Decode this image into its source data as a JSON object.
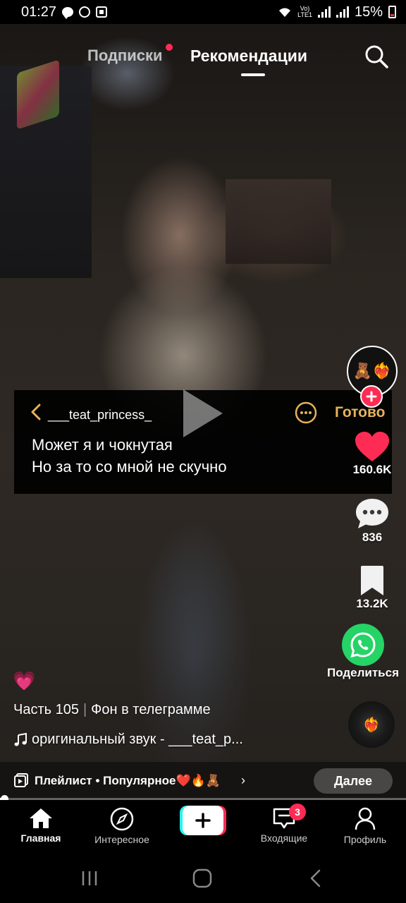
{
  "status_bar": {
    "time": "01:27",
    "lte_label": "Vo)\nLTE1",
    "battery": "15%"
  },
  "top_nav": {
    "tab_following": "Подписки",
    "tab_recommended": "Рекомендации",
    "active_tab": "Рекомендации"
  },
  "lyrics_card": {
    "username": "___teat_princess_",
    "done_label": "Готово",
    "line1": "Может я и чокнутая",
    "line2": "Но за то со мной не скучно"
  },
  "actions": {
    "avatar_emoji": "🧸❤️‍🔥",
    "likes": "160.6K",
    "comments": "836",
    "saves": "13.2K",
    "share_label": "Поделиться",
    "disc_emoji": "❤️‍🔥"
  },
  "caption": {
    "emoji": "💗",
    "part": "Часть 105",
    "text": "Фон в телеграмме",
    "sound": "оригинальный звук - ___teat_p..."
  },
  "playlist": {
    "label": "Плейлист • Популярное❤️🔥🧸",
    "next_label": "Далее"
  },
  "progress": {
    "fraction": 0.01
  },
  "bottom_nav": {
    "home": "Главная",
    "discover": "Интересное",
    "inbox": "Входящие",
    "inbox_badge": "3",
    "profile": "Профиль"
  },
  "colors": {
    "accent": "#fe2c55",
    "cyan": "#25f4ee",
    "done": "#e6b35a",
    "whatsapp": "#25d366"
  }
}
